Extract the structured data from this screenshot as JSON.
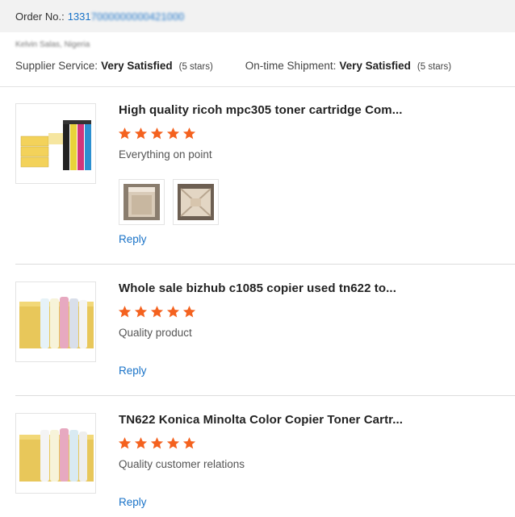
{
  "order": {
    "label": "Order No.:",
    "number_visible": "1331",
    "number_obscured": "7000000000421000"
  },
  "buyer": {
    "name_obscured": "Kelvin Salas, Nigeria"
  },
  "ratings": {
    "supplier_label": "Supplier Service:",
    "supplier_value": "Very Satisfied",
    "supplier_stars": "(5 stars)",
    "shipment_label": "On-time Shipment:",
    "shipment_value": "Very Satisfied",
    "shipment_stars": "(5 stars)"
  },
  "reviews": [
    {
      "title": "High quality ricoh mpc305 toner cartridge Com...",
      "stars": 5,
      "comment": "Everything on point",
      "reply": "Reply",
      "has_photos": true
    },
    {
      "title": "Whole sale bizhub c1085 copier used tn622 to...",
      "stars": 5,
      "comment": "Quality product",
      "reply": "Reply",
      "has_photos": false
    },
    {
      "title": "TN622 Konica Minolta Color Copier Toner Cartr...",
      "stars": 5,
      "comment": "Quality customer relations",
      "reply": "Reply",
      "has_photos": false
    }
  ],
  "colors": {
    "link": "#1a73c8",
    "star": "#f4621f",
    "divider": "#dcdcdc"
  }
}
